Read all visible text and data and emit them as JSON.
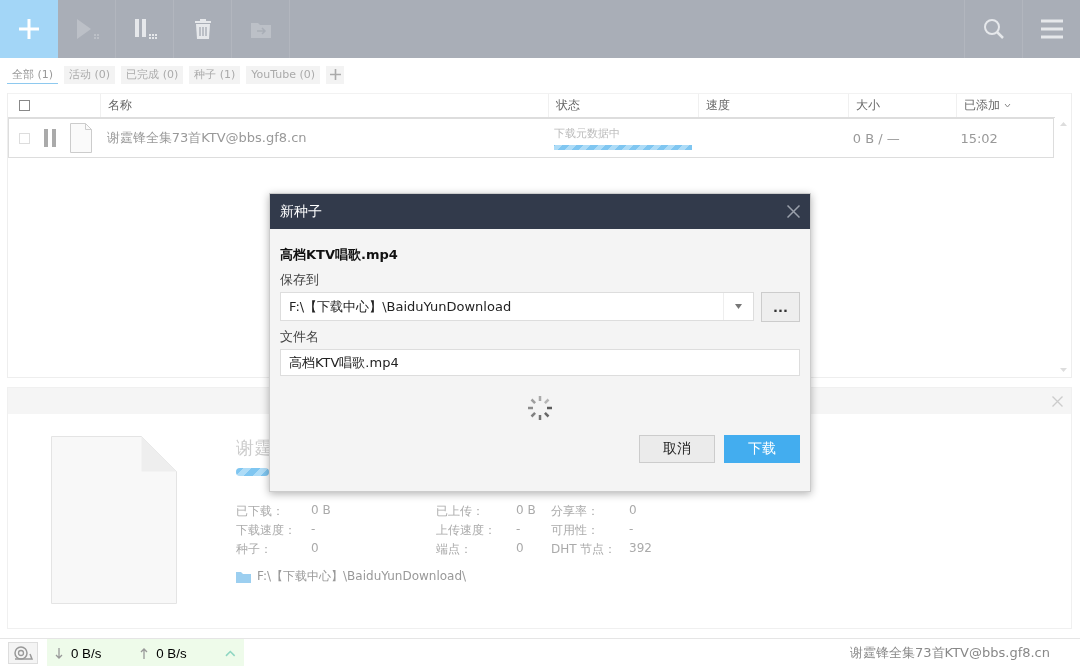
{
  "toolbar": {
    "buttons": [
      {
        "kind": "add",
        "disabled": false
      },
      {
        "kind": "start",
        "disabled": true
      },
      {
        "kind": "pause",
        "disabled": false
      },
      {
        "kind": "delete",
        "disabled": false
      },
      {
        "kind": "move",
        "disabled": true
      }
    ]
  },
  "filters": [
    {
      "label": "全部 (1)",
      "selected": true
    },
    {
      "label": "活动 (0)",
      "selected": false
    },
    {
      "label": "已完成 (0)",
      "selected": false
    },
    {
      "label": "种子 (1)",
      "selected": false
    },
    {
      "label": "YouTube (0)",
      "selected": false
    }
  ],
  "table": {
    "header_checked": false,
    "columns": [
      {
        "label": "名称",
        "sorted": false
      },
      {
        "label": "状态",
        "sorted": false
      },
      {
        "label": "速度",
        "sorted": false
      },
      {
        "label": "大小",
        "sorted": false
      },
      {
        "label": "已添加",
        "sorted": true
      }
    ],
    "rows": [
      {
        "checked": false,
        "name": "谢霆锋全集73首KTV@bbs.gf8.cn",
        "status": "下载元数据中",
        "level": 1,
        "size": "0 B / —",
        "added": "15:02"
      }
    ]
  },
  "details": {
    "title": "谢霆",
    "level": 1,
    "stats": [
      [
        {
          "label": "已下载：",
          "value": "0 B"
        },
        {
          "label": "下载速度：",
          "value": "-"
        },
        {
          "label": "种子：",
          "value": "0"
        }
      ],
      [
        {
          "label": "已上传：",
          "value": "0 B"
        },
        {
          "label": "上传速度：",
          "value": "-"
        },
        {
          "label": "端点：",
          "value": "0"
        }
      ],
      [
        {
          "label": "分享率：",
          "value": "0"
        },
        {
          "label": "可用性：",
          "value": "-"
        },
        {
          "label": "DHT 节点：",
          "value": "392"
        }
      ]
    ],
    "path": "F:\\【下载中心】\\BaiduYunDownload\\"
  },
  "status_bar": {
    "download_speed": "0 B/s",
    "upload_speed": "0 B/s",
    "current": "谢霆锋全集73首KTV@bbs.gf8.cn"
  },
  "dialog": {
    "title": "新种子",
    "file_title": "高档KTV唱歌.mp4",
    "save_label": "保存到",
    "save_path": "F:\\【下载中心】\\BaiduYunDownload",
    "browse": "...",
    "filename_label": "文件名",
    "filename": "高档KTV唱歌.mp4",
    "buttons": [
      {
        "label": "取消",
        "kind": "secondary"
      },
      {
        "label": "下载",
        "kind": "primary"
      }
    ]
  }
}
